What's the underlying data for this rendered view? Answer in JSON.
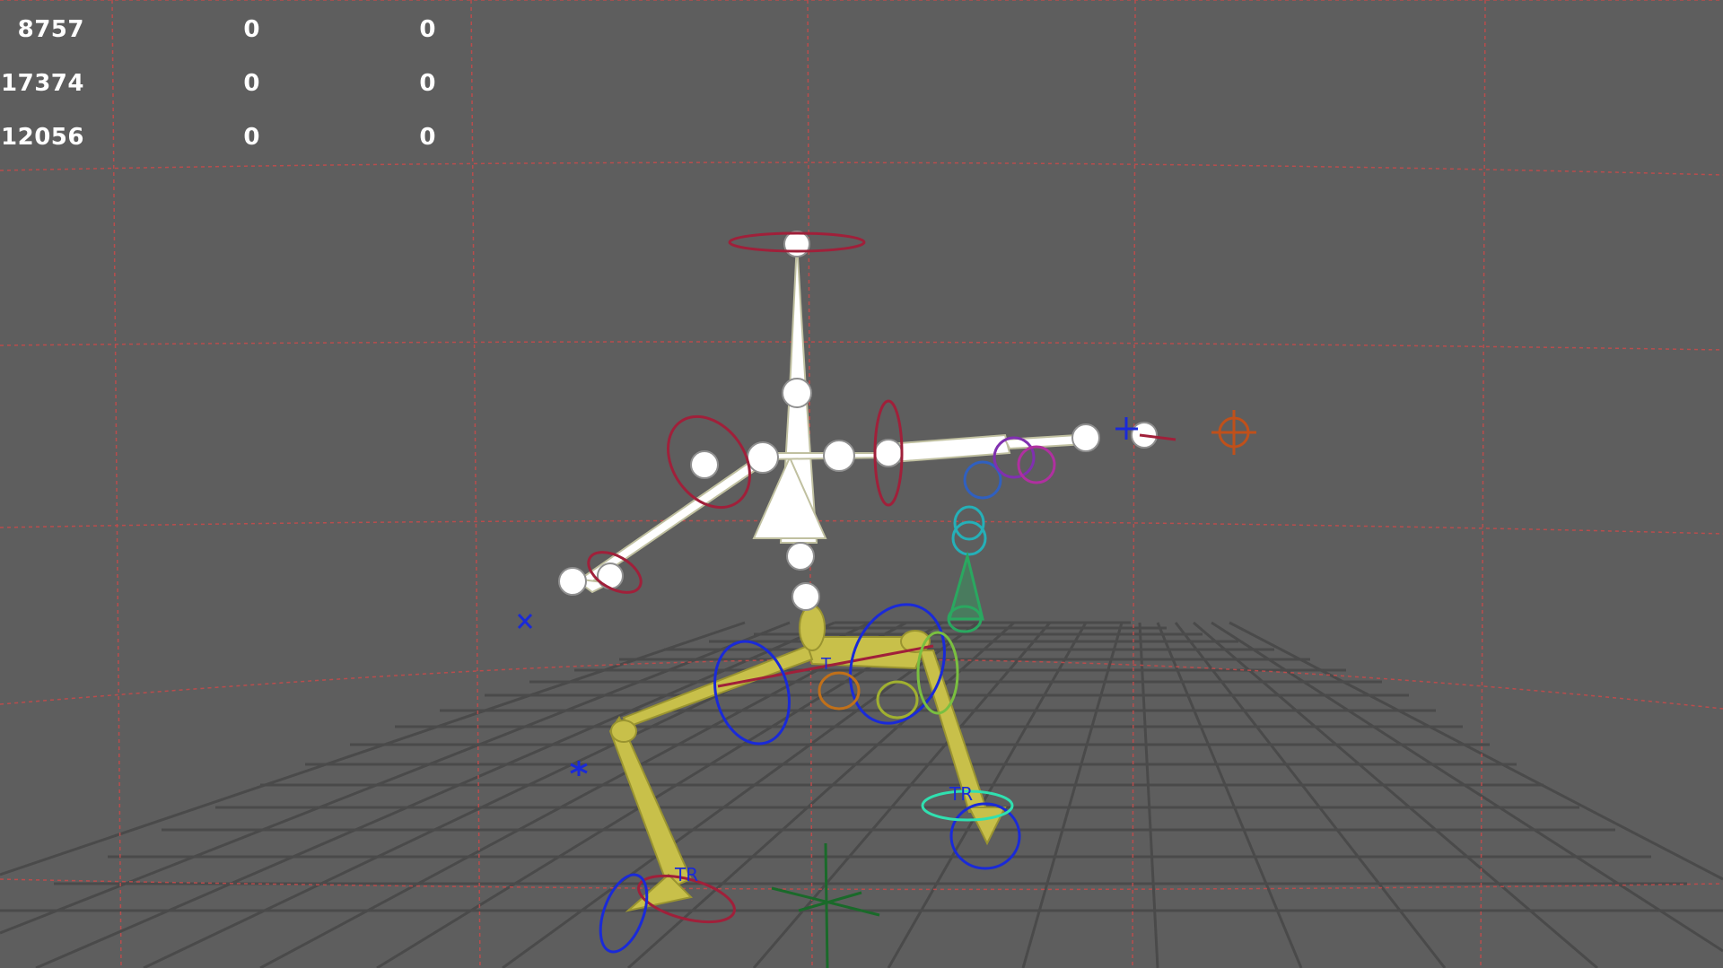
{
  "hud": {
    "rows": [
      [
        "8757",
        "0",
        "0"
      ],
      [
        "17374",
        "0",
        "0"
      ],
      [
        "12056",
        "0",
        "0"
      ]
    ]
  },
  "labels": {
    "left_foot": "TR",
    "right_foot": "TR",
    "pelvis": "T"
  },
  "colors": {
    "background": "#5e5e5e",
    "floor_grid": "#4a4a4a",
    "guide_grid": "#c94a4a",
    "bones_upper": "#ffffff",
    "bones_lower": "#c8c04a",
    "rotation_red": "#a0203a",
    "rotation_blue": "#1a2ad8",
    "spine_green": "#2aa860",
    "spine_teal": "#25b0b8",
    "effector_orange": "#c0501a",
    "origin_green": "#1a6a2a"
  }
}
